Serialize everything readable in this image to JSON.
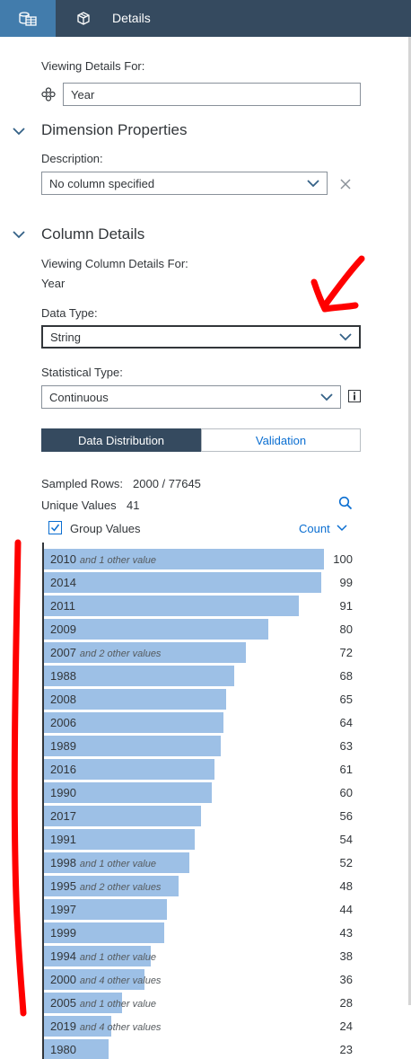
{
  "header": {
    "title": "Details"
  },
  "viewing": {
    "label": "Viewing Details For:",
    "value": "Year"
  },
  "dimension": {
    "section_title": "Dimension Properties",
    "description_label": "Description:",
    "description_value": "No column specified"
  },
  "column": {
    "section_title": "Column Details",
    "viewing_label": "Viewing Column Details For:",
    "viewing_value": "Year",
    "data_type_label": "Data Type:",
    "data_type_value": "String",
    "stat_type_label": "Statistical Type:",
    "stat_type_value": "Continuous"
  },
  "tabs": {
    "distribution": "Data Distribution",
    "validation": "Validation"
  },
  "stats": {
    "sampled_label": "Sampled Rows:",
    "sampled_value": "2000 / 77645",
    "unique_label": "Unique Values",
    "unique_value": "41",
    "group_label": "Group Values",
    "sort_label": "Count"
  },
  "colors": {
    "header_bg": "#354a5f",
    "active_tab": "#427cac",
    "bar": "#9dc0e6",
    "accent": "#0a6ed1",
    "annotation": "#ff0000"
  },
  "chart_data": {
    "type": "bar",
    "orientation": "horizontal",
    "categories": [
      "2010",
      "2014",
      "2011",
      "2009",
      "2007",
      "1988",
      "2008",
      "2006",
      "1989",
      "2016",
      "1990",
      "2017",
      "1991",
      "1998",
      "1995",
      "1997",
      "1999",
      "1994",
      "2000",
      "2005",
      "2019",
      "1980"
    ],
    "extra": [
      "and 1 other value",
      "",
      "",
      "",
      "and 2 other values",
      "",
      "",
      "",
      "",
      "",
      "",
      "",
      "",
      "and 1 other value",
      "and 2 other values",
      "",
      "",
      "and 1 other value",
      "and 4 other values",
      "and 1 other value",
      "and 4 other values",
      ""
    ],
    "values": [
      100,
      99,
      91,
      80,
      72,
      68,
      65,
      64,
      63,
      61,
      60,
      56,
      54,
      52,
      48,
      44,
      43,
      38,
      36,
      28,
      24,
      23
    ],
    "xlim": [
      0,
      100
    ]
  }
}
